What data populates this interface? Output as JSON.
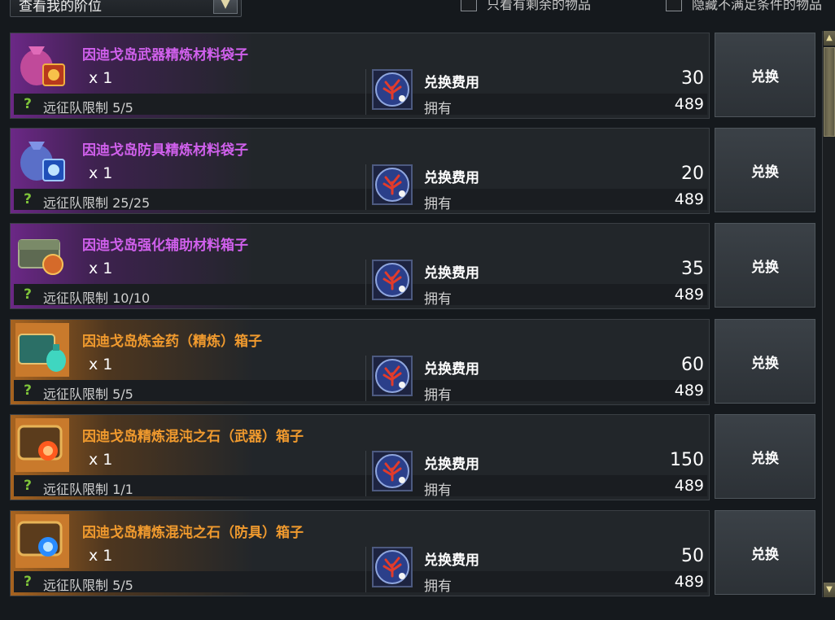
{
  "filters": {
    "rank_select_label": "查看我的阶位",
    "dropdown_arrow": "▼",
    "only_remaining_label": "只看有剩余的物品",
    "hide_unmet_label": "隐藏不满足条件的物品"
  },
  "common": {
    "cost_label": "兑换费用",
    "own_label": "拥有",
    "exchange_label": "兑换",
    "help_glyph": "?"
  },
  "items": [
    {
      "name": "因迪戈岛武器精炼材料袋子",
      "rarity": "purple",
      "icon": "weapon-material-bag-icon",
      "quantity": "x 1",
      "limit": "远征队限制 5/5",
      "cost": "30",
      "owned": "489"
    },
    {
      "name": "因迪戈岛防具精炼材料袋子",
      "rarity": "purple",
      "icon": "armor-material-bag-icon",
      "quantity": "x 1",
      "limit": "远征队限制 25/25",
      "cost": "20",
      "owned": "489"
    },
    {
      "name": "因迪戈岛强化辅助材料箱子",
      "rarity": "purple",
      "icon": "enhancement-material-chest-icon",
      "quantity": "x 1",
      "limit": "远征队限制 10/10",
      "cost": "35",
      "owned": "489"
    },
    {
      "name": "因迪戈岛炼金药（精炼）箱子",
      "rarity": "orange",
      "icon": "alchemy-potion-chest-icon",
      "quantity": "x 1",
      "limit": "远征队限制 5/5",
      "cost": "60",
      "owned": "489"
    },
    {
      "name": "因迪戈岛精炼混沌之石（武器）箱子",
      "rarity": "orange",
      "icon": "chaos-stone-weapon-chest-icon",
      "quantity": "x 1",
      "limit": "远征队限制 1/1",
      "cost": "150",
      "owned": "489"
    },
    {
      "name": "因迪戈岛精炼混沌之石（防具）箱子",
      "rarity": "orange",
      "icon": "chaos-stone-armor-chest-icon",
      "quantity": "x 1",
      "limit": "远征队限制 5/5",
      "cost": "50",
      "owned": "489"
    }
  ],
  "currency_icon": "coral-currency-icon",
  "colors": {
    "purple_name": "#d060ec",
    "orange_name": "#f09a2e",
    "help_green": "#7ec33a"
  }
}
